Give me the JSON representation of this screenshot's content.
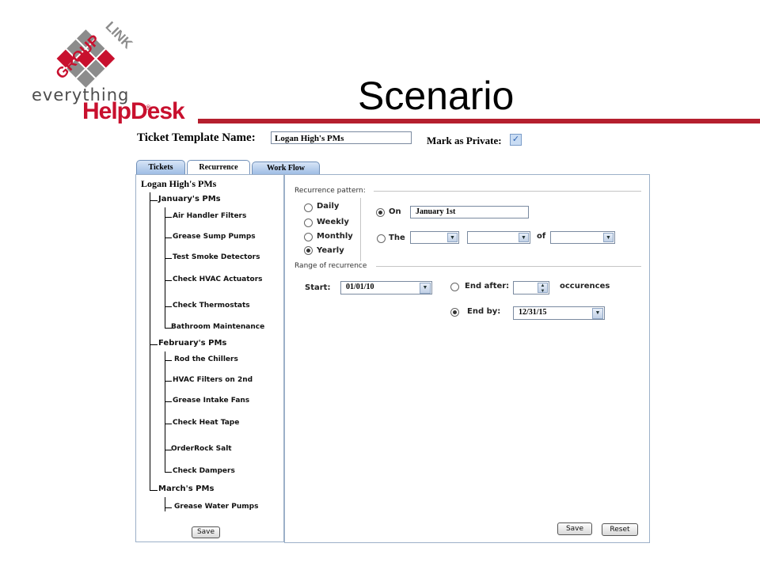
{
  "logo": {
    "word_top": "GROUP",
    "word_side": "LINK",
    "tagline": "everything",
    "product": "HelpDesk",
    "tm": "®"
  },
  "slide": {
    "title": "Scenario",
    "accent_color": "#b51f2e"
  },
  "form": {
    "template_name_label": "Ticket Template Name:",
    "template_name_value": "Logan High's PMs",
    "private_label": "Mark as Private:",
    "private_checked": true
  },
  "tabs": [
    {
      "label": "Tickets",
      "active": false
    },
    {
      "label": "Recurrence",
      "active": true
    },
    {
      "label": "Work Flow",
      "active": false
    }
  ],
  "tree": {
    "root": "Logan High's PMs",
    "folders": [
      {
        "label": "January's PMs",
        "items": [
          "Air Handler Filters",
          "Grease Sump Pumps",
          "Test Smoke Detectors",
          "Check HVAC Actuators",
          "Check Thermostats",
          "Bathroom Maintenance"
        ]
      },
      {
        "label": "February's PMs",
        "items": [
          "Rod the Chillers",
          "HVAC Filters on 2nd",
          "Grease Intake Fans",
          "Check Heat Tape",
          "OrderRock Salt",
          "Check Dampers"
        ]
      },
      {
        "label": "March's PMs",
        "items": [
          "Grease Water Pumps"
        ]
      }
    ],
    "save_label": "Save"
  },
  "recurrence": {
    "pattern_label": "Recurrence pattern:",
    "frequencies": [
      {
        "label": "Daily",
        "selected": false
      },
      {
        "label": "Weekly",
        "selected": false
      },
      {
        "label": "Monthly",
        "selected": false
      },
      {
        "label": "Yearly",
        "selected": true
      }
    ],
    "on_label": "On",
    "on_value": "January 1st",
    "on_selected": true,
    "the_label": "The",
    "of_label": "of",
    "range_label": "Range of recurrence",
    "start_label": "Start:",
    "start_value": "01/01/10",
    "end_after_label": "End after:",
    "occurrences_label": "occurences",
    "end_by_label": "End by:",
    "end_by_value": "12/31/15",
    "end_by_selected": true,
    "save_label": "Save",
    "reset_label": "Reset"
  }
}
